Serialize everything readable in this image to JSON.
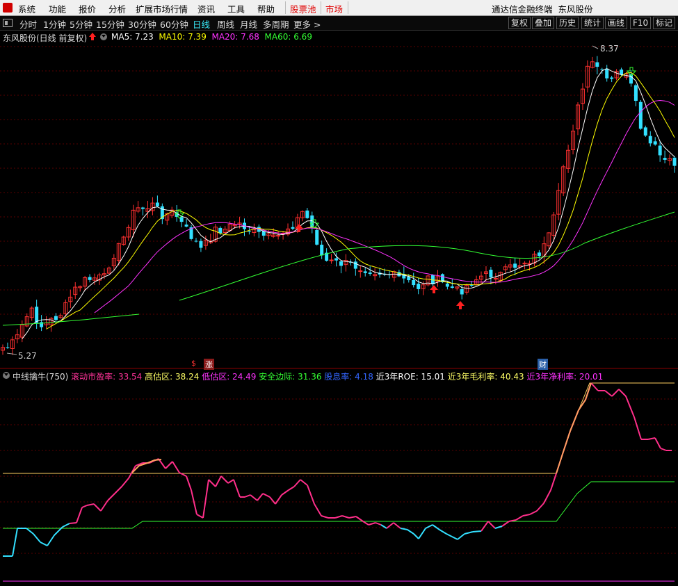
{
  "menu": {
    "items": [
      "系统",
      "功能",
      "报价",
      "分析",
      "扩展市场行情",
      "资讯",
      "工具",
      "帮助"
    ],
    "hot_items": [
      "股票池",
      "市场"
    ],
    "app_title": "通达信金融终端",
    "stock_title": "东风股份"
  },
  "period_tabs": [
    "分时",
    "1分钟",
    "5分钟",
    "15分钟",
    "30分钟",
    "60分钟",
    "日线",
    "周线",
    "月线",
    "多周期",
    "更多 >"
  ],
  "active_period": "日线",
  "right_buttons": [
    "复权",
    "叠加",
    "历史",
    "统计",
    "画线",
    "F10",
    "标记"
  ],
  "main_legend": {
    "title": "东风股份(日线 前复权)",
    "ma5": "MA5: 7.23",
    "ma10": "MA10: 7.39",
    "ma20": "MA20: 7.68",
    "ma60": "MA60: 6.69",
    "high_label": "8.37",
    "low_label": "5.27",
    "colors": {
      "ma5": "#ffffff",
      "ma10": "#ffff00",
      "ma20": "#ff33ff",
      "ma60": "#33ff33"
    }
  },
  "markers": {
    "s": "$",
    "zhang": "涨",
    "cai": "财"
  },
  "indicator_legend": {
    "name": "中线擒牛(750)",
    "pe": "滚动市盈率: 33.54",
    "high_zone": "高估区: 38.24",
    "low_zone": "低估区: 24.49",
    "safety": "安全边际: 31.36",
    "dividend": "股息率: 4.18",
    "roe": "近3年ROE: 15.01",
    "gross": "近3年毛利率: 40.43",
    "net": "近3年净利率: 20.01",
    "colors": {
      "pe": "#ff3399",
      "high": "#ffff66",
      "low": "#ff33ff",
      "safety": "#33ff33",
      "dividend": "#3366ff",
      "roe": "#ffffff",
      "gross": "#ffff66",
      "net": "#ff33ff"
    }
  },
  "chart_data": {
    "type": "candlestick+indicator",
    "price_axis": {
      "ymin": 5.0,
      "ymax": 8.6
    },
    "high": 8.37,
    "low": 5.27,
    "indicator_axis": {
      "ymin": 14.0,
      "ymax": 45.0
    },
    "indicator_levels": {
      "high_zone": 38.24,
      "low_zone": 24.49,
      "net_margin": 20.01,
      "gross_margin": 40.43
    }
  }
}
